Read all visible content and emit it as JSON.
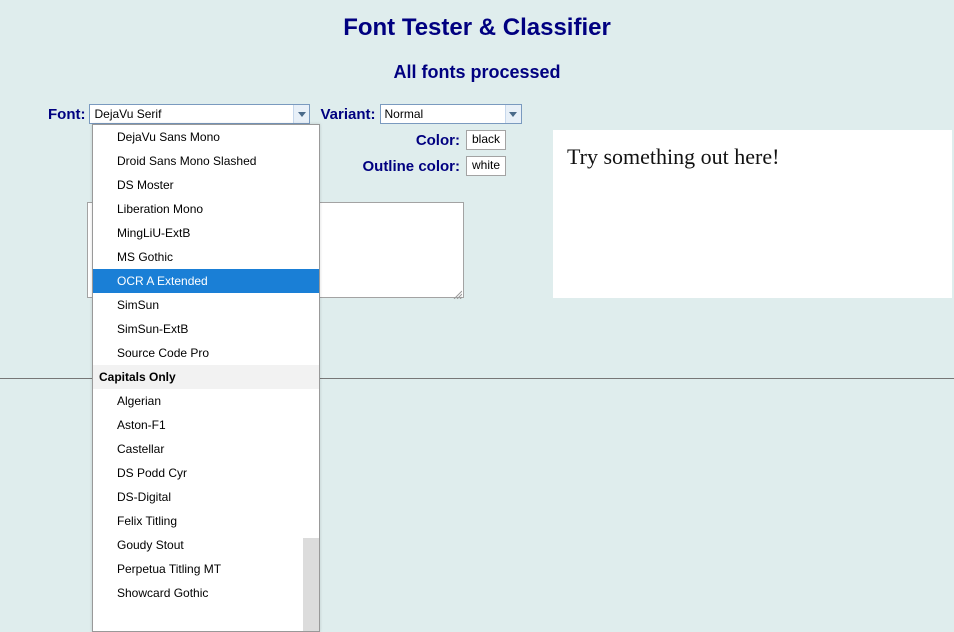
{
  "header": {
    "title": "Font Tester & Classifier",
    "subtitle": "All fonts processed"
  },
  "controls": {
    "font_label": "Font:",
    "font_value": "DejaVu Serif",
    "variant_label": "Variant:",
    "variant_value": "Normal",
    "color_label": "Color:",
    "color_value": "black",
    "outline_label": "Outline color:",
    "outline_value": "white"
  },
  "preview": {
    "text": "Try something out here!"
  },
  "dropdown": {
    "options": [
      {
        "label": "DejaVu Sans Mono",
        "type": "opt"
      },
      {
        "label": "Droid Sans Mono Slashed",
        "type": "opt"
      },
      {
        "label": "DS Moster",
        "type": "opt"
      },
      {
        "label": "Liberation Mono",
        "type": "opt"
      },
      {
        "label": "MingLiU-ExtB",
        "type": "opt"
      },
      {
        "label": "MS Gothic",
        "type": "opt"
      },
      {
        "label": "OCR A Extended",
        "type": "opt",
        "highlight": true
      },
      {
        "label": "SimSun",
        "type": "opt"
      },
      {
        "label": "SimSun-ExtB",
        "type": "opt"
      },
      {
        "label": "Source Code Pro",
        "type": "opt"
      },
      {
        "label": "Capitals Only",
        "type": "optgroup"
      },
      {
        "label": "Algerian",
        "type": "opt"
      },
      {
        "label": "Aston-F1",
        "type": "opt"
      },
      {
        "label": "Castellar",
        "type": "opt"
      },
      {
        "label": "DS Podd Cyr",
        "type": "opt"
      },
      {
        "label": "DS-Digital",
        "type": "opt"
      },
      {
        "label": "Felix Titling",
        "type": "opt"
      },
      {
        "label": "Goudy Stout",
        "type": "opt"
      },
      {
        "label": "Perpetua Titling MT",
        "type": "opt"
      },
      {
        "label": "Showcard Gothic",
        "type": "opt"
      }
    ]
  }
}
